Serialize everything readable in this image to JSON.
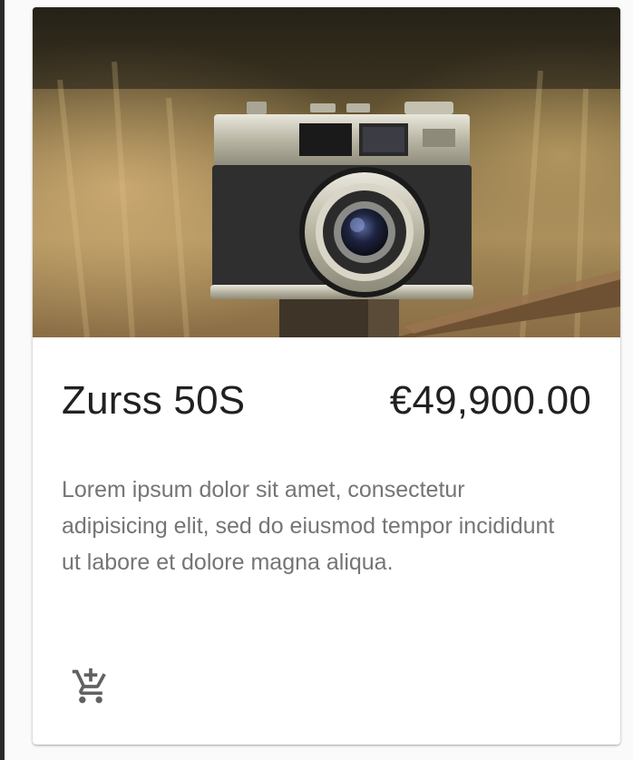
{
  "product": {
    "title": "Zurss 50S",
    "price": "€49,900.00",
    "description": "Lorem ipsum dolor sit amet, consectetur adipisicing elit, sed do eiusmod tempor incididunt ut labore et dolore magna aliqua."
  },
  "actions": {
    "add_to_cart_icon": "add-shopping-cart-icon"
  },
  "colors": {
    "title_text": "#212121",
    "description_text": "#757575",
    "icon": "#616161",
    "card_background": "#ffffff"
  }
}
